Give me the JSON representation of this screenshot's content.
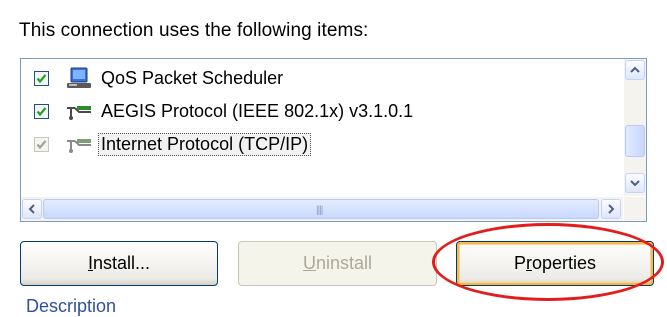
{
  "heading": "This connection uses the following items:",
  "items": [
    {
      "label": "QoS Packet Scheduler",
      "checked": true,
      "enabled": true,
      "icon": "network-service-icon"
    },
    {
      "label": "AEGIS Protocol (IEEE 802.1x) v3.1.0.1",
      "checked": true,
      "enabled": true,
      "icon": "protocol-icon"
    },
    {
      "label": "Internet Protocol (TCP/IP)",
      "checked": true,
      "enabled": false,
      "selected": true,
      "icon": "protocol-icon"
    }
  ],
  "buttons": {
    "install": {
      "pre": "",
      "ul": "I",
      "post": "nstall..."
    },
    "uninstall": {
      "pre": "",
      "ul": "U",
      "post": "ninstall"
    },
    "properties": {
      "pre": "P",
      "ul": "r",
      "post": "operties"
    }
  },
  "description_partial": "Description",
  "colors": {
    "highlight_circle": "#e21d1d",
    "default_button_glow": "#f8b848"
  }
}
